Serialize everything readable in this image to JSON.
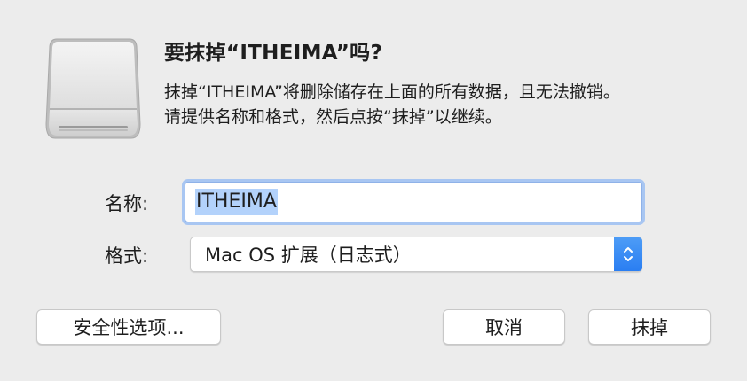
{
  "dialog": {
    "title": "要抹掉“ITHEIMA”吗?",
    "message_line1": "抹掉“ITHEIMA”将删除储存在上面的所有数据，且无法撤销。",
    "message_line2": "请提供名称和格式，然后点按“抹掉”以继续。",
    "icon": "external-drive-icon"
  },
  "form": {
    "name_label": "名称:",
    "name_value": "ITHEIMA",
    "format_label": "格式:",
    "format_value": "Mac OS 扩展（日志式）",
    "format_stepper_icon": "up-down-chevron-icon"
  },
  "buttons": {
    "security": "安全性选项...",
    "cancel": "取消",
    "erase": "抹掉"
  },
  "colors": {
    "background": "#ececec",
    "selection": "#b3d2fb",
    "focus_ring": "#a8c6f2",
    "stepper": "#2a7ef2"
  }
}
